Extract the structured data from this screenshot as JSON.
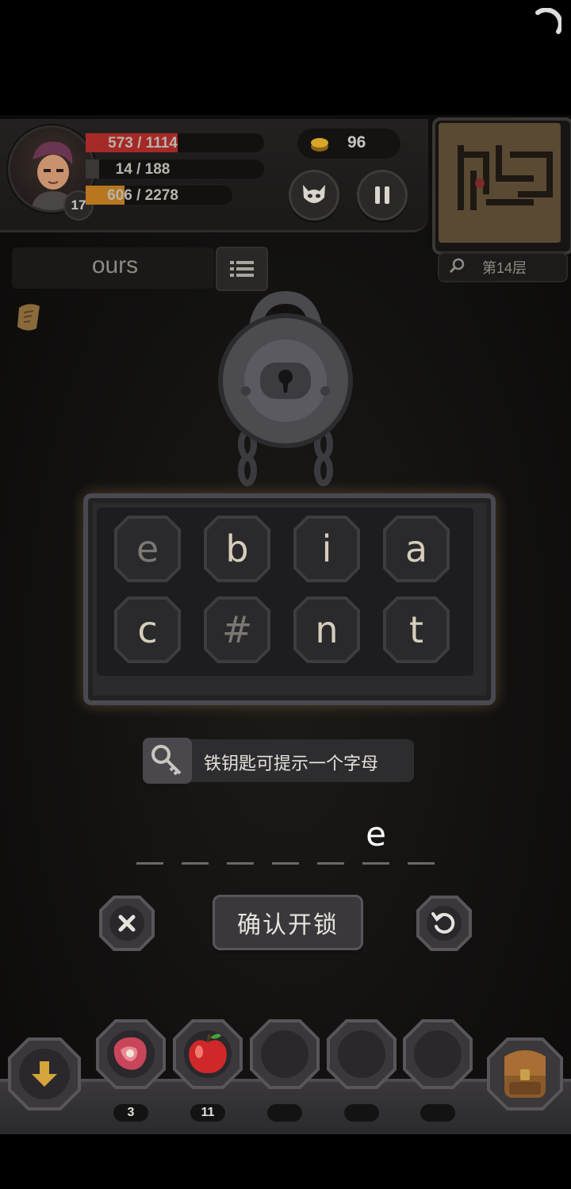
{
  "status_bar": {
    "spinner_icon": "loading-spinner-icon"
  },
  "hud": {
    "hp_text": "573 / 1114",
    "hp_fraction": 0.514,
    "mp_text": "14 / 188",
    "mp_fraction": 0.074,
    "xp_text": "606 / 2278",
    "xp_fraction": 0.266,
    "level": "17",
    "gold": "96",
    "floor_label": "第14层"
  },
  "word_panel": {
    "word": "ours"
  },
  "lock_puzzle": {
    "letters": [
      "e",
      "b",
      "i",
      "a",
      "c",
      "#",
      "n",
      "t"
    ],
    "hint_text": "铁钥匙可提示一个字母",
    "answer_slots": [
      "",
      "",
      "",
      "",
      "",
      "e",
      ""
    ],
    "confirm_label": "确认开锁"
  },
  "inventory": {
    "counts": [
      "3",
      "11",
      "",
      "",
      ""
    ],
    "items": [
      "meat-icon",
      "apple-icon",
      "empty",
      "empty",
      "empty"
    ]
  },
  "colors": {
    "hp": "#a52a27",
    "mp": "#2e2c2a",
    "xp": "#b8761f",
    "accent": "#d6cdbb"
  }
}
